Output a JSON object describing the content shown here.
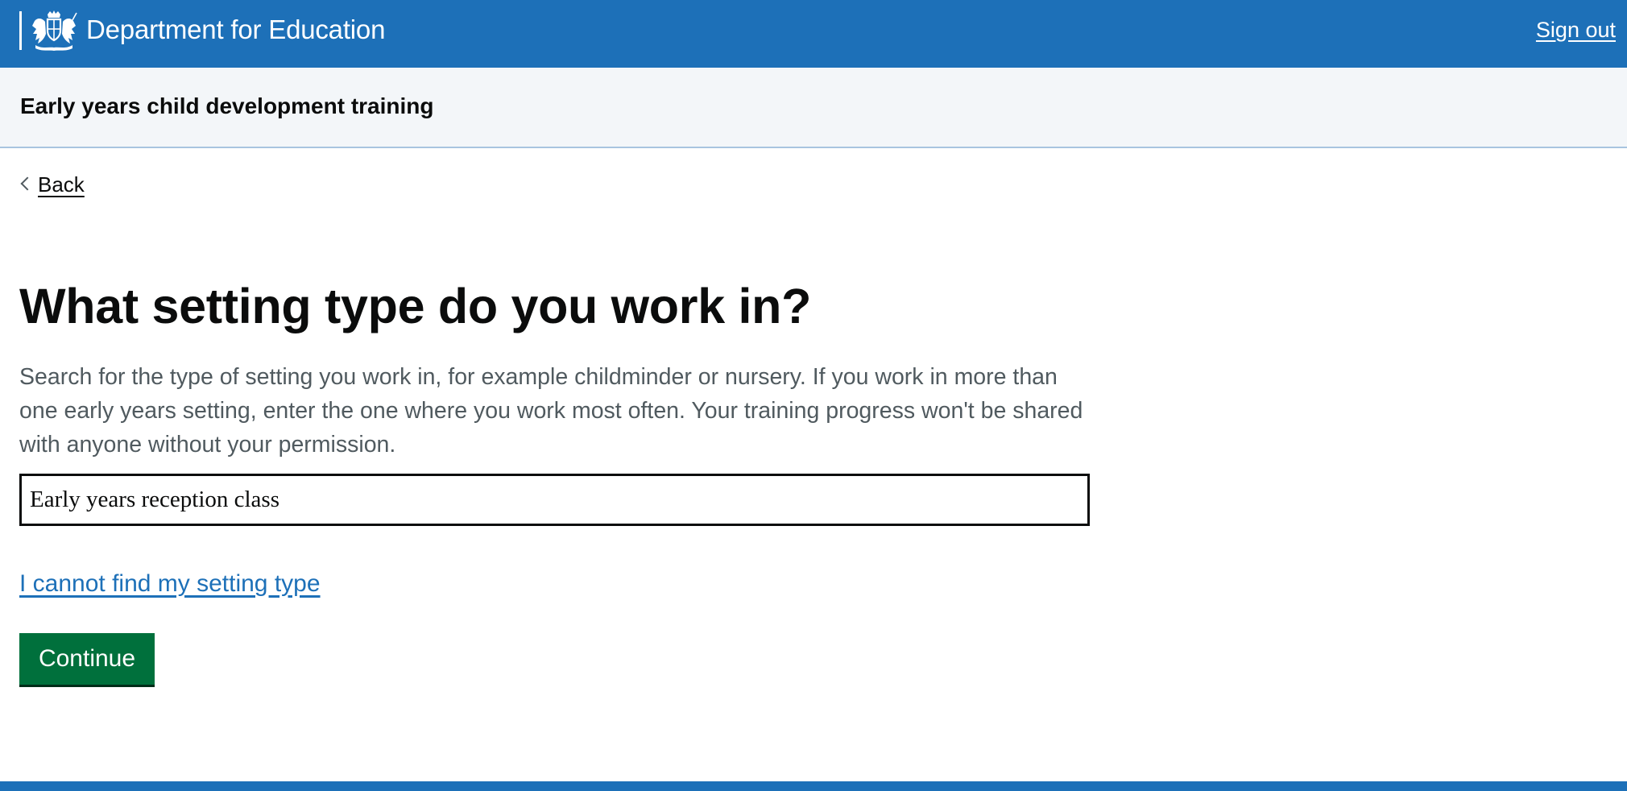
{
  "header": {
    "department": "Department for Education",
    "crest_icon": "royal-coat-of-arms-icon",
    "sign_out_label": "Sign out",
    "background_color": "#1d70b8"
  },
  "service": {
    "name": "Early years child development training"
  },
  "navigation": {
    "back_label": "Back",
    "back_icon": "chevron-left-icon"
  },
  "question": {
    "heading": "What setting type do you work in?",
    "hint": "Search for the type of setting you work in, for example childminder or nursery. If you work in more than one early years setting, enter the one where you work most often. Your training progress won't be shared with anyone without your permission.",
    "setting_type_value": "Early years reception class",
    "cannot_find_link": "I cannot find my setting type",
    "continue_label": "Continue"
  },
  "colors": {
    "link_blue": "#1d70b8",
    "button_green": "#00703c",
    "hint_grey": "#505a5f",
    "text": "#0b0c0c"
  }
}
